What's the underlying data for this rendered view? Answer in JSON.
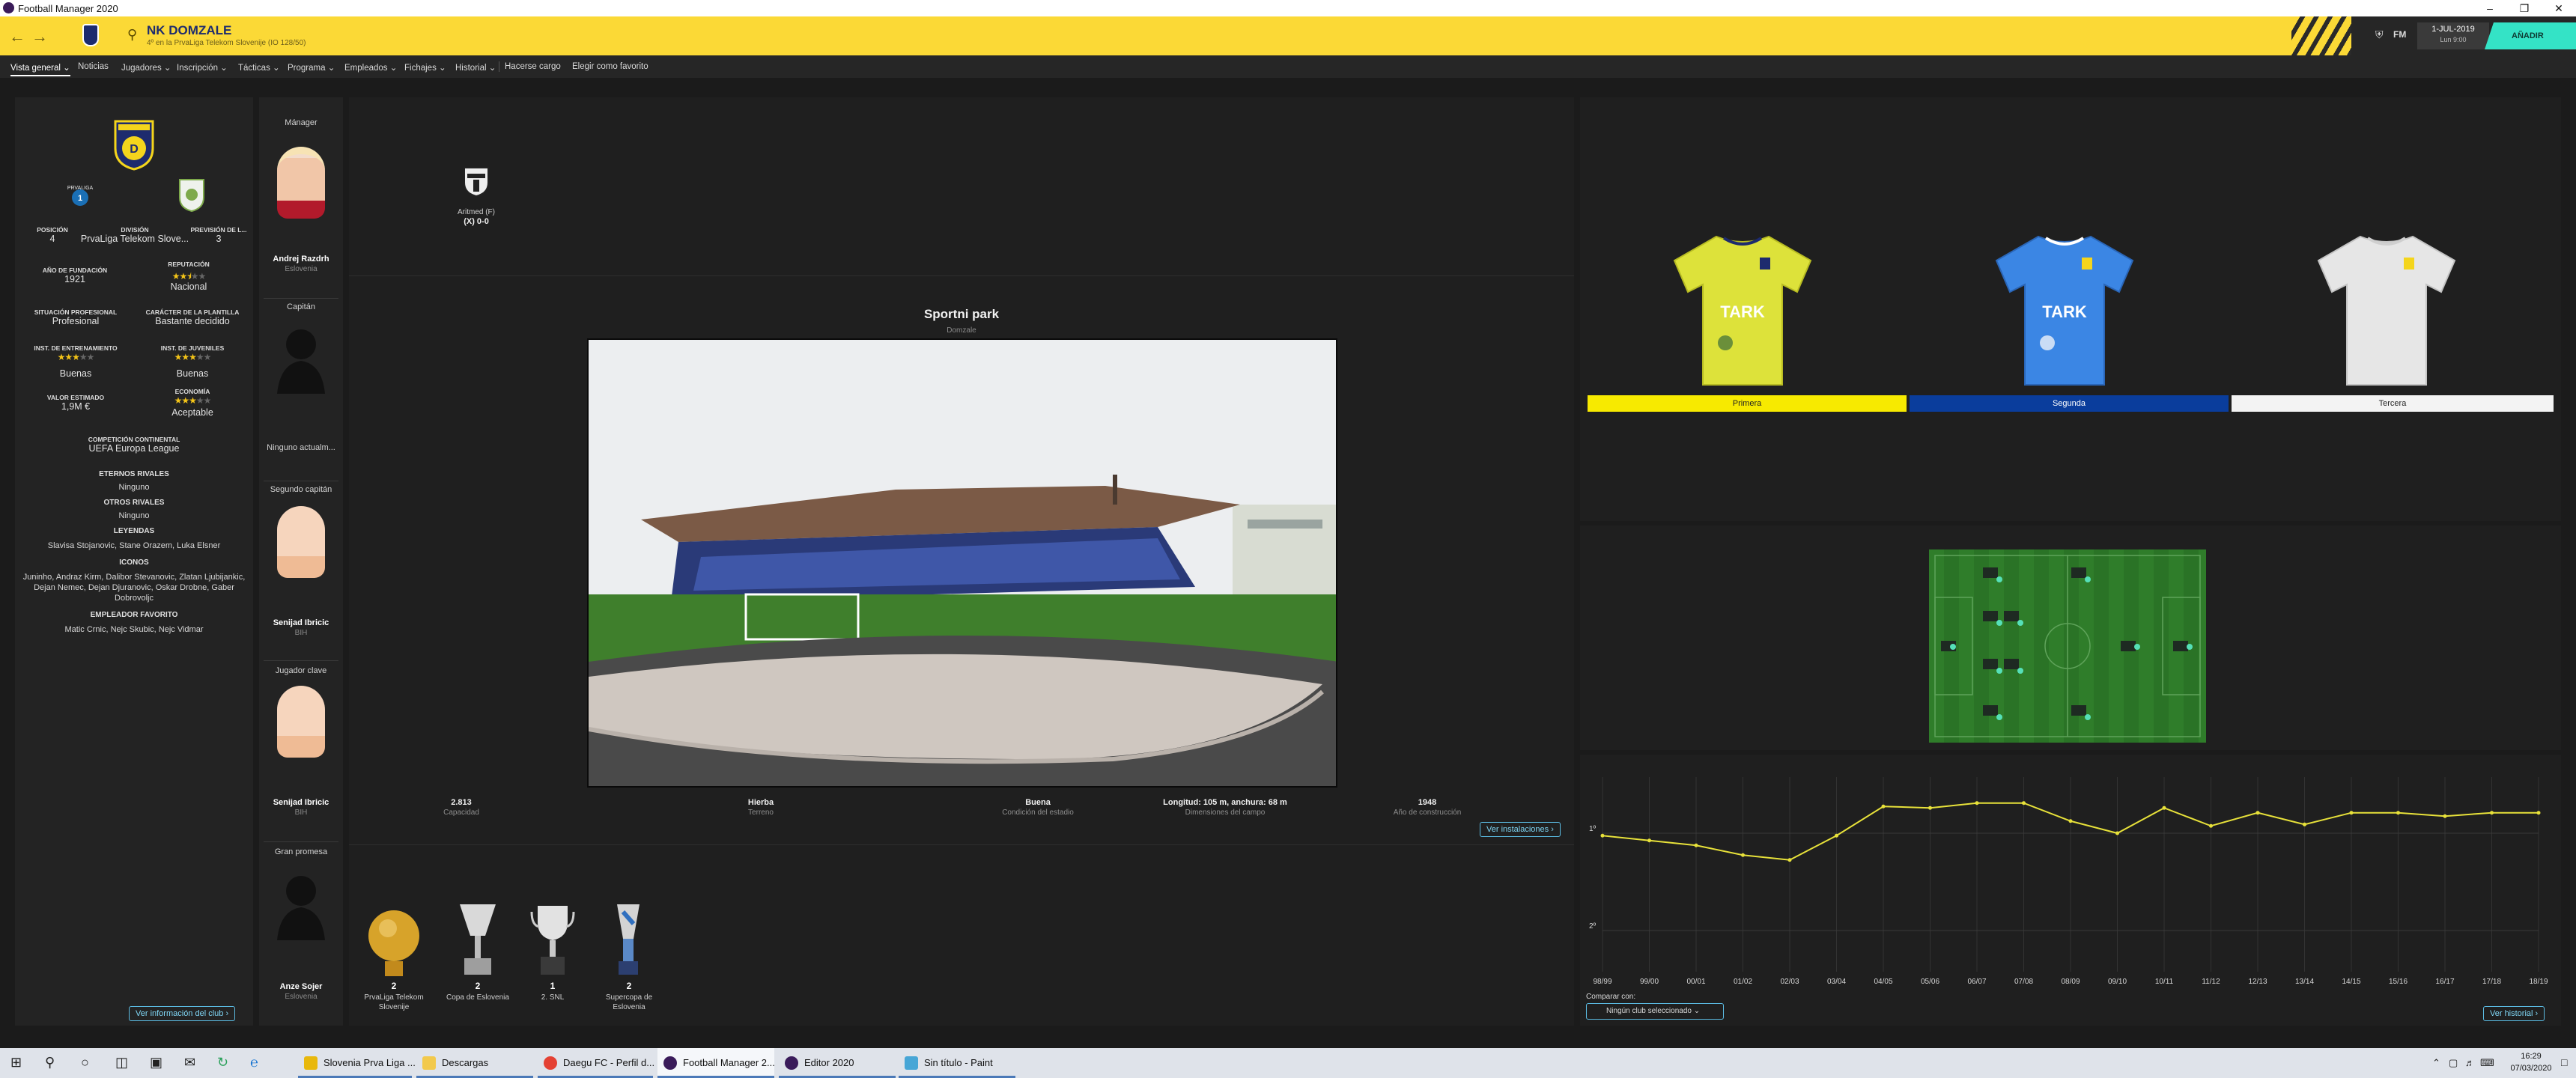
{
  "window": {
    "title": "Football Manager 2020"
  },
  "header": {
    "club_name": "NK DOMZALE",
    "club_subtitle": "4º en la PrvaLiga Telekom Slovenije (IO 128/50)",
    "date_line1": "1-JUL-2019",
    "date_line2": "Lun 9:00",
    "continue_label": "AÑADIR",
    "fm_label": "FM"
  },
  "menu": [
    {
      "label": "Vista general",
      "dropdown": true,
      "active": true
    },
    {
      "label": "Noticias",
      "dropdown": false
    },
    {
      "label": "Jugadores",
      "dropdown": true
    },
    {
      "label": "Inscripción",
      "dropdown": true
    },
    {
      "label": "Tácticas",
      "dropdown": true
    },
    {
      "label": "Programa",
      "dropdown": true
    },
    {
      "label": "Empleados",
      "dropdown": true
    },
    {
      "label": "Fichajes",
      "dropdown": true
    },
    {
      "label": "Historial",
      "dropdown": true
    },
    {
      "label": "Hacerse cargo",
      "dropdown": false
    },
    {
      "label": "Elegir como favorito",
      "dropdown": false
    }
  ],
  "club_info": {
    "league_badge_text": "PRVALIGA",
    "posicion": {
      "label": "POSICIÓN",
      "value": "4"
    },
    "division": {
      "label": "DIVISIÓN",
      "value": "PrvaLiga Telekom Slove..."
    },
    "prevision": {
      "label": "PREVISIÓN DE L...",
      "value": "3"
    },
    "fundacion": {
      "label": "AÑO DE FUNDACIÓN",
      "value": "1921"
    },
    "reputacion": {
      "label": "REPUTACIÓN",
      "stars": 2.5,
      "value": "Nacional"
    },
    "situacion": {
      "label": "SITUACIÓN PROFESIONAL",
      "value": "Profesional"
    },
    "caracter": {
      "label": "CARÁCTER DE LA PLANTILLA",
      "value": "Bastante decidido"
    },
    "entrenamiento": {
      "label": "INST. DE ENTRENAMIENTO",
      "stars": 3,
      "value": "Buenas"
    },
    "juveniles": {
      "label": "INST. DE JUVENILES",
      "stars": 3,
      "value": "Buenas"
    },
    "valor": {
      "label": "VALOR ESTIMADO",
      "value": "1,9M €"
    },
    "economia": {
      "label": "ECONOMÍA",
      "stars": 3,
      "value": "Aceptable"
    },
    "continental": {
      "label": "COMPETICIÓN CONTINENTAL",
      "value": "UEFA Europa League"
    },
    "eternos": {
      "label": "ETERNOS RIVALES",
      "value": "Ninguno"
    },
    "otros": {
      "label": "OTROS RIVALES",
      "value": "Ninguno"
    },
    "leyendas": {
      "label": "LEYENDAS",
      "value": "Slavisa Stojanovic, Stane Orazem, Luka Elsner"
    },
    "iconos": {
      "label": "ICONOS",
      "value": "Juninho, Andraz Kirm, Dalibor Stevanovic, Zlatan Ljubijankic, Dejan Nemec, Dejan Djuranovic, Oskar Drobne, Gaber Dobrovoljc"
    },
    "empleador": {
      "label": "EMPLEADOR FAVORITO",
      "value": "Matic Crnic, Nejc Skubic, Nejc Vidmar"
    },
    "link": "Ver información del club"
  },
  "staff": [
    {
      "role": "Mánager",
      "name": "Andrej Razdrh",
      "nat": "Eslovenia",
      "face": true
    },
    {
      "role": "Capitán",
      "name": "Ninguno actualm...",
      "nat": "",
      "face": false
    },
    {
      "role": "Segundo capitán",
      "name": "Senijad Ibricic",
      "nat": "BIH",
      "face": true
    },
    {
      "role": "Jugador clave",
      "name": "Senijad Ibricic",
      "nat": "BIH",
      "face": true
    },
    {
      "role": "Gran promesa",
      "name": "Anze Sojer",
      "nat": "Eslovenia",
      "face": false
    }
  ],
  "last_match": {
    "opponent": "Aritmed (F)",
    "score": "(X) 0-0"
  },
  "stadium": {
    "name": "Sportni park",
    "city": "Domzale",
    "stats": [
      {
        "value": "2.813",
        "label": "Capacidad"
      },
      {
        "value": "Hierba",
        "label": "Terreno"
      },
      {
        "value": "Buena",
        "label": "Condición del estadio"
      },
      {
        "value": "Longitud: 105 m, anchura: 68 m",
        "label": "Dimensiones del campo"
      },
      {
        "value": "1948",
        "label": "Año de construcción"
      }
    ],
    "link": "Ver instalaciones"
  },
  "trophies": [
    {
      "count": "2",
      "name": "PrvaLiga Telekom Slovenije"
    },
    {
      "count": "2",
      "name": "Copa de Eslovenia"
    },
    {
      "count": "1",
      "name": "2. SNL"
    },
    {
      "count": "2",
      "name": "Supercopa de Eslovenia"
    }
  ],
  "kits": [
    {
      "label": "Primera",
      "bar_color": "#f7ea00",
      "text_color": "#222",
      "shirt": "#dde23a"
    },
    {
      "label": "Segunda",
      "bar_color": "#0a3d9c",
      "text_color": "#fff",
      "shirt": "#3b86e4"
    },
    {
      "label": "Tercera",
      "bar_color": "#f3f3f3",
      "text_color": "#222",
      "shirt": "#e6e6e6"
    }
  ],
  "history": {
    "compare_label": "Comparar con:",
    "compare_value": "Ningún club seleccionado",
    "link": "Ver historial"
  },
  "chart_data": {
    "type": "line",
    "x": [
      "98/99",
      "99/00",
      "00/01",
      "01/02",
      "02/03",
      "03/04",
      "04/05",
      "05/06",
      "06/07",
      "07/08",
      "08/09",
      "09/10",
      "10/11",
      "11/12",
      "12/13",
      "13/14",
      "14/15",
      "15/16",
      "16/17",
      "17/18",
      "18/19"
    ],
    "values": [
      1.05,
      1.15,
      1.25,
      1.45,
      1.55,
      1.05,
      0.45,
      0.48,
      0.38,
      0.38,
      0.75,
      1.0,
      0.48,
      0.85,
      0.58,
      0.82,
      0.58,
      0.58,
      0.65,
      0.58,
      0.58
    ],
    "yticks": [
      "1º",
      "2º"
    ],
    "color": "#e8e23a",
    "grid": true
  },
  "taskbar": {
    "items": [
      {
        "label": "Slovenia Prva Liga ...",
        "color": "#e8b80c"
      },
      {
        "label": "Descargas",
        "color": "#f2c94c"
      },
      {
        "label": "Daegu FC - Perfil d...",
        "color": "#e44133"
      },
      {
        "label": "Football Manager 2...",
        "color": "#3a1b5a"
      },
      {
        "label": "Editor 2020",
        "color": "#3a1b5a"
      },
      {
        "label": "Sin título - Paint",
        "color": "#47a6d6"
      }
    ],
    "time": "16:29",
    "date": "07/03/2020"
  }
}
